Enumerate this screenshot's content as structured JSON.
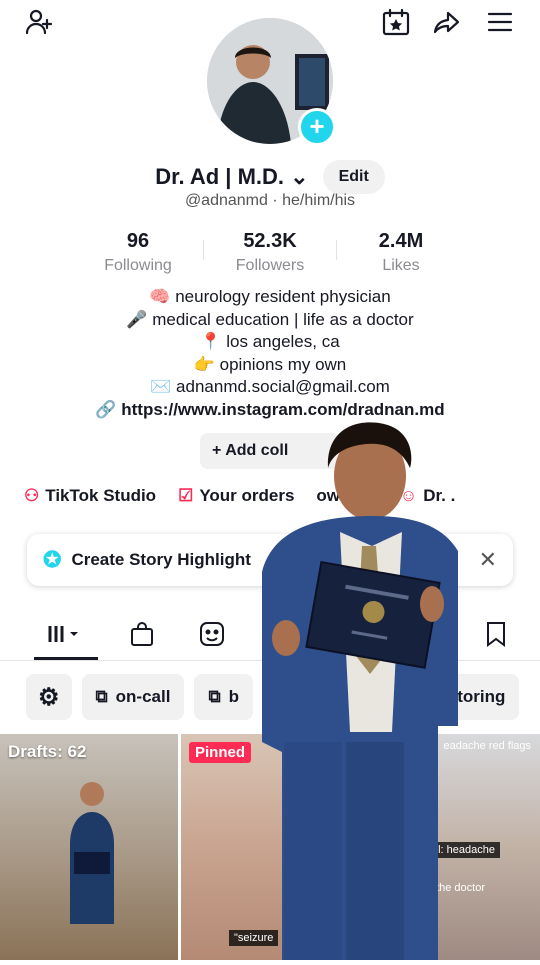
{
  "profile": {
    "name": "Dr. Ad | M.D.",
    "edit_label": "Edit",
    "handle": "@adnanmd · he/him/his"
  },
  "stats": [
    {
      "value": "96",
      "label": "Following"
    },
    {
      "value": "52.3K",
      "label": "Followers"
    },
    {
      "value": "2.4M",
      "label": "Likes"
    }
  ],
  "bio": [
    {
      "emoji": "🧠",
      "text": "neurology resident physician"
    },
    {
      "emoji": "🎤",
      "text": "medical education | life as a doctor"
    },
    {
      "emoji": "📍",
      "text": "los angeles, ca"
    },
    {
      "emoji": "👉",
      "text": "opinions my own"
    },
    {
      "emoji": "✉️",
      "text": "adnanmd.social@gmail.com"
    },
    {
      "emoji": "🔗",
      "text": "https://www.instagram.com/dradnan.md"
    }
  ],
  "add_collection": "+ Add coll",
  "shortcuts": [
    "TikTok Studio",
    "Your orders",
    "owcase",
    "Dr. ."
  ],
  "story": {
    "label": "Create Story Highlight"
  },
  "chips": [
    "on-call",
    "b",
    "Doctoring"
  ],
  "grid": {
    "drafts_label": "Drafts: 62",
    "pinned_label": "Pinned",
    "caption_seizure": "\"seizure",
    "caption_headache_flags": "eadache red flags",
    "caption_oncall": "-call: headache",
    "caption_doctor": "you're the doctor"
  },
  "colors": {
    "accent": "#fe2c55",
    "teal": "#20d5ec"
  }
}
